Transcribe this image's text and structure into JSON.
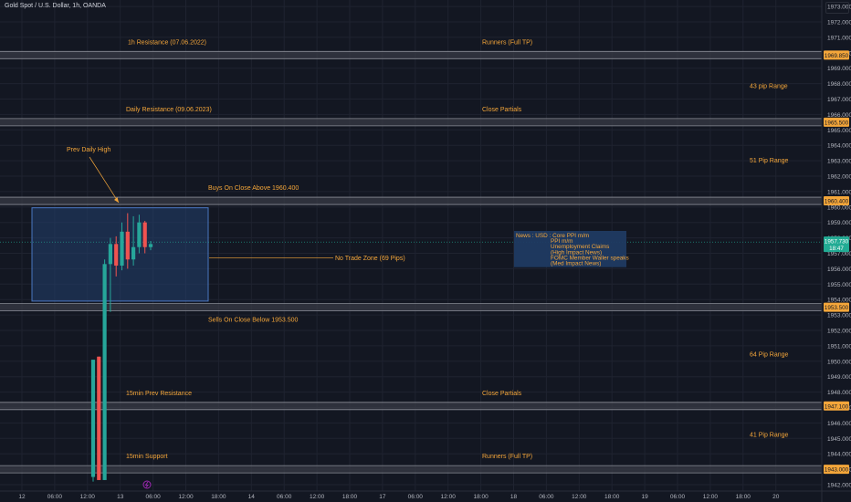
{
  "header": {
    "symbol_title": "Gold Spot / U.S. Dollar, 1h, OANDA"
  },
  "colors": {
    "background": "#131722",
    "grid": "#1f2330",
    "axis_text": "#b2b5be",
    "label_orange": "#f4a63a",
    "level_line": "#8a8d96",
    "level_band": "#3a3d47",
    "up_candle": "#26a69a",
    "down_candle": "#ef5350",
    "zone_fill": "#22406e",
    "zone_border": "#4a78c2",
    "news_fill": "#1f3a62",
    "current_price": "#22ab94"
  },
  "chart_data": {
    "type": "candlestick",
    "title": "Gold Spot / U.S. Dollar, 1h, OANDA",
    "y_axis": {
      "ylim": [
        1941.3,
        1973.8
      ],
      "ticks": [
        1942,
        1943,
        1944,
        1945,
        1946,
        1947,
        1948,
        1949,
        1950,
        1951,
        1952,
        1953,
        1954,
        1955,
        1956,
        1957,
        1958,
        1959,
        1960,
        1961,
        1962,
        1963,
        1964,
        1965,
        1966,
        1967,
        1968,
        1969,
        1970,
        1971,
        1972,
        1973
      ]
    },
    "x_axis": {
      "tick_labels": [
        "12",
        "06:00",
        "12:00",
        "13",
        "06:00",
        "12:00",
        "18:00",
        "14",
        "06:00",
        "12:00",
        "18:00",
        "17",
        "06:00",
        "12:00",
        "18:00",
        "18",
        "06:00",
        "12:00",
        "18:00",
        "19",
        "06:00",
        "12:00",
        "18:00",
        "20"
      ]
    },
    "levels": [
      {
        "price": 1969.85,
        "label": "1h Resistance (07.06.2022)",
        "right_label": "Runners (Full TP)",
        "price_label": "1969.850"
      },
      {
        "price": 1965.5,
        "label": "Daily Resistance (09.06.2023)",
        "right_label": "Close Partials",
        "price_label": "1965.500"
      },
      {
        "price": 1960.4,
        "label": "Buys On Close Above 1960.400",
        "right_label": "",
        "price_label": "1960.400"
      },
      {
        "price": 1953.5,
        "label": "Sells On Close Below 1953.500",
        "right_label": "",
        "price_label": "1953.500"
      },
      {
        "price": 1947.1,
        "label": "15min Prev Resistance",
        "right_label": "Close Partials",
        "price_label": "1947.100"
      },
      {
        "price": 1943.0,
        "label": "15min Support",
        "right_label": "Runners (Full TP)",
        "price_label": "1943.000"
      }
    ],
    "range_labels": [
      {
        "text": "43 pip Range",
        "price": 1967.7
      },
      {
        "text": "51 Pip Range",
        "price": 1962.9
      },
      {
        "text": "64 Pip Range",
        "price": 1950.3
      },
      {
        "text": "41 Pip Range",
        "price": 1945.1
      }
    ],
    "annotations": {
      "prev_daily_high": "Prev Daily High",
      "no_trade_zone": "No Trade Zone (69 Pips)",
      "news": [
        "News : USD : Core PPI m/m",
        "PPI m/m",
        "Unemployment  Claims",
        "(High Impact News)",
        "FOMC Member Waller speaks",
        "(Med Impact News)"
      ]
    },
    "candles": [
      {
        "o": 1942.5,
        "h": 1950.1,
        "l": 1942.2,
        "c": 1950.1
      },
      {
        "o": 1950.3,
        "h": 1950.3,
        "l": 1942.3,
        "c": 1942.3
      },
      {
        "o": 1942.3,
        "h": 1956.6,
        "l": 1942.3,
        "c": 1956.3
      },
      {
        "o": 1956.3,
        "h": 1958.0,
        "l": 1953.2,
        "c": 1957.6
      },
      {
        "o": 1957.6,
        "h": 1958.1,
        "l": 1955.5,
        "c": 1956.2
      },
      {
        "o": 1956.2,
        "h": 1959.0,
        "l": 1955.9,
        "c": 1958.4
      },
      {
        "o": 1958.4,
        "h": 1959.6,
        "l": 1956.0,
        "c": 1956.6
      },
      {
        "o": 1956.6,
        "h": 1959.4,
        "l": 1956.2,
        "c": 1957.4
      },
      {
        "o": 1957.4,
        "h": 1959.5,
        "l": 1957.0,
        "c": 1959.0
      },
      {
        "o": 1959.0,
        "h": 1959.1,
        "l": 1957.0,
        "c": 1957.4
      },
      {
        "o": 1957.4,
        "h": 1957.8,
        "l": 1957.2,
        "c": 1957.6
      }
    ],
    "current_price": {
      "price": 1957.73,
      "label": "1957.730",
      "countdown": "18:47"
    }
  }
}
